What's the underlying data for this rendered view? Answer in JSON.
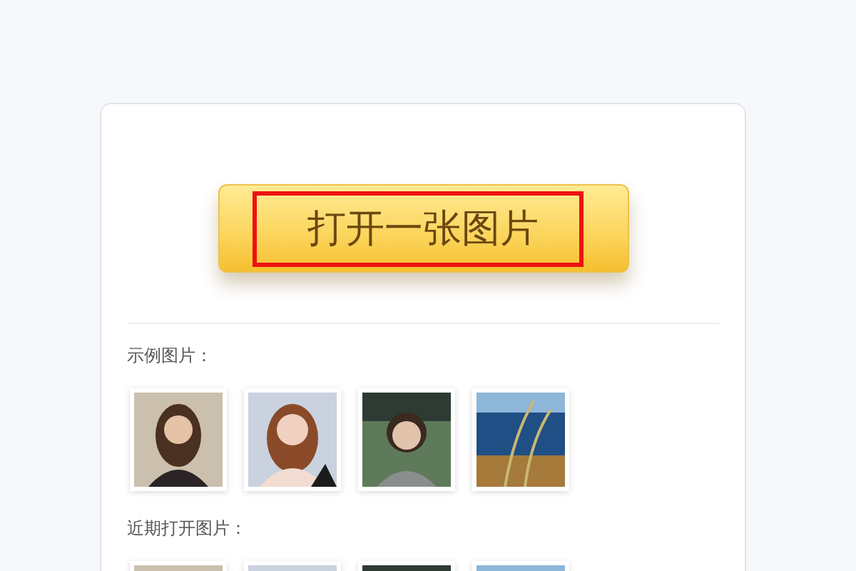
{
  "open_button": {
    "label": "打开一张图片",
    "highlighted": true
  },
  "sample_images": {
    "label": "示例图片："
  },
  "recent_images": {
    "label": "近期打开图片："
  }
}
